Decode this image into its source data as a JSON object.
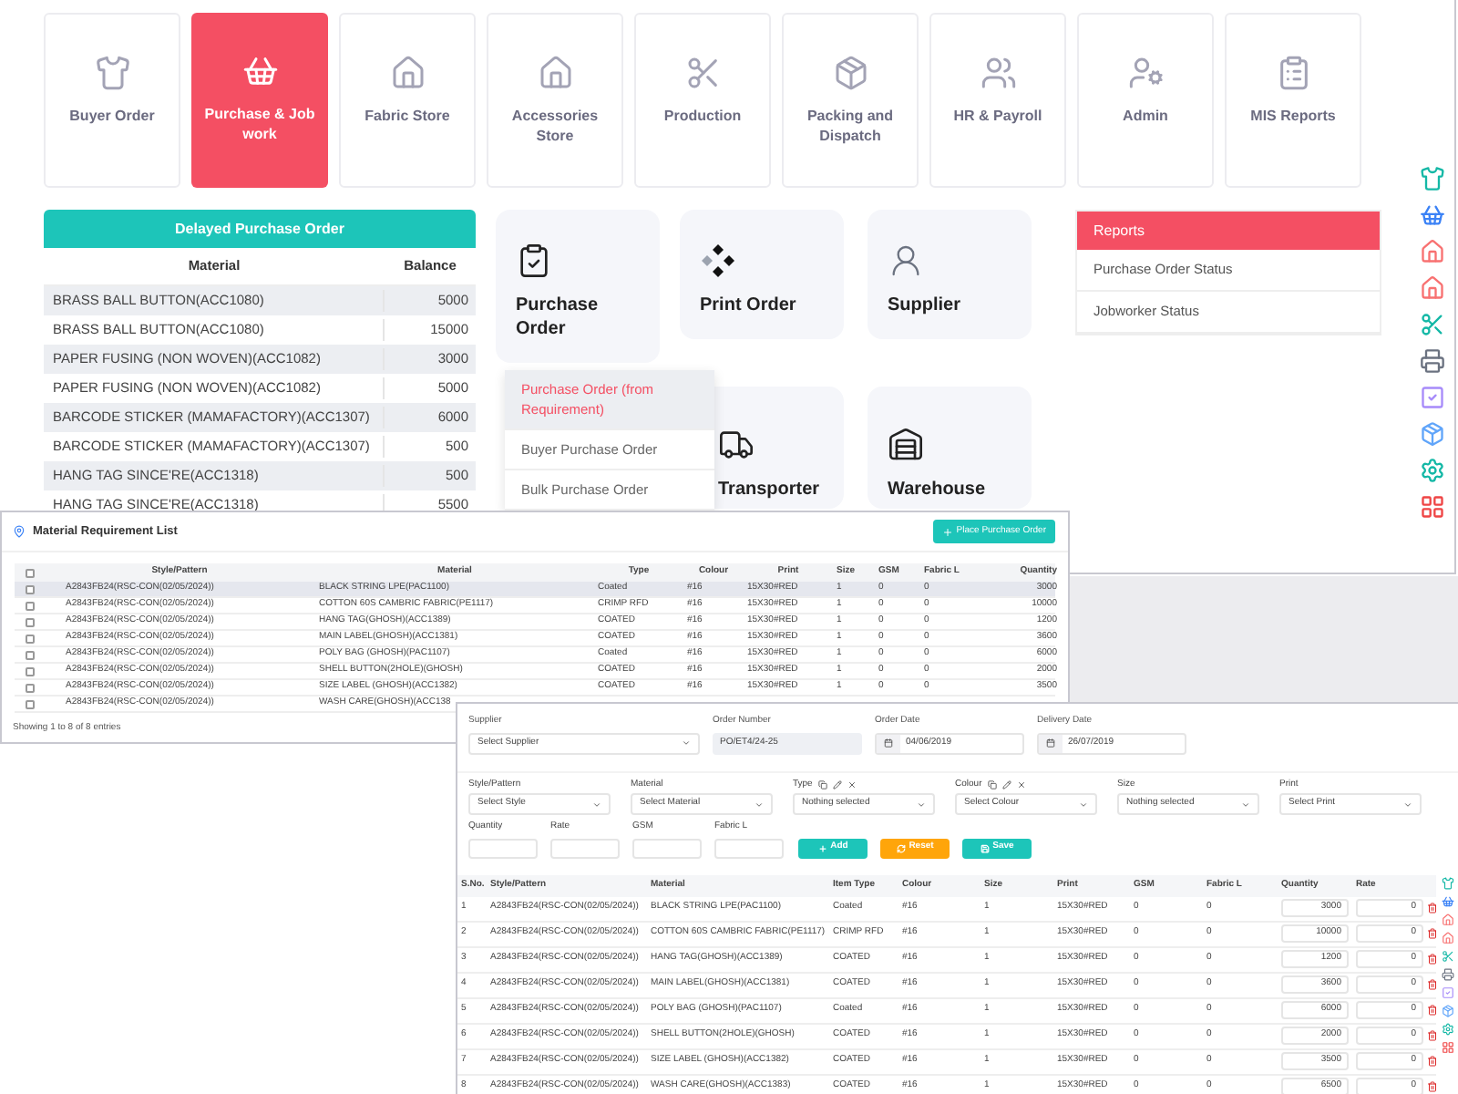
{
  "nav": [
    {
      "label": "Buyer Order",
      "selected": false
    },
    {
      "label": "Purchase & Job work",
      "selected": true
    },
    {
      "label": "Fabric Store",
      "selected": false
    },
    {
      "label": "Accessories Store",
      "selected": false
    },
    {
      "label": "Production",
      "selected": false
    },
    {
      "label": "Packing and Dispatch",
      "selected": false
    },
    {
      "label": "HR & Payroll",
      "selected": false
    },
    {
      "label": "Admin",
      "selected": false
    },
    {
      "label": "MIS Reports",
      "selected": false
    }
  ],
  "delayed_purchase_order": {
    "title": "Delayed Purchase Order",
    "columns": [
      "Material",
      "Balance"
    ],
    "rows": [
      {
        "material": "BRASS BALL BUTTON(ACC1080)",
        "balance": "5000"
      },
      {
        "material": "BRASS BALL BUTTON(ACC1080)",
        "balance": "15000"
      },
      {
        "material": "PAPER FUSING (NON WOVEN)(ACC1082)",
        "balance": "3000"
      },
      {
        "material": "PAPER FUSING (NON WOVEN)(ACC1082)",
        "balance": "5000"
      },
      {
        "material": "BARCODE STICKER (MAMAFACTORY)(ACC1307)",
        "balance": "6000"
      },
      {
        "material": "BARCODE STICKER (MAMAFACTORY)(ACC1307)",
        "balance": "500"
      },
      {
        "material": "HANG TAG SINCE'RE(ACC1318)",
        "balance": "500"
      },
      {
        "material": "HANG TAG SINCE'RE(ACC1318)",
        "balance": "5500"
      }
    ]
  },
  "tiles": [
    {
      "label": "Purchase Order"
    },
    {
      "label": "Print Order"
    },
    {
      "label": "Supplier"
    },
    {
      "label": "Transporter"
    },
    {
      "label": "Warehouse"
    }
  ],
  "tile_menu": [
    {
      "label": "Purchase Order (from Requirement)",
      "selected": true
    },
    {
      "label": "Buyer Purchase Order",
      "selected": false
    },
    {
      "label": "Bulk Purchase Order",
      "selected": false
    }
  ],
  "reports": {
    "title": "Reports",
    "items": [
      "Purchase Order Status",
      "Jobworker Status"
    ]
  },
  "material_requirement_list": {
    "title": "Material Requirement List",
    "button": "Place Purchase Order",
    "header_checked": false,
    "columns": [
      "Style/Pattern",
      "Material",
      "Type",
      "Colour",
      "Print",
      "Size",
      "GSM",
      "Fabric L",
      "Quantity"
    ],
    "rows": [
      {
        "selected": true,
        "checked": false,
        "cells": [
          "A2843FB24(RSC-CON(02/05/2024))",
          "BLACK STRING LPE(PAC1100)",
          "Coated",
          "#16",
          "15X30#RED",
          "1",
          "0",
          "0",
          "3000"
        ]
      },
      {
        "selected": false,
        "checked": false,
        "cells": [
          "A2843FB24(RSC-CON(02/05/2024))",
          "COTTON 60S CAMBRIC FABRIC(PE1117)",
          "CRIMP RFD",
          "#16",
          "15X30#RED",
          "1",
          "0",
          "0",
          "10000"
        ]
      },
      {
        "selected": false,
        "checked": false,
        "cells": [
          "A2843FB24(RSC-CON(02/05/2024))",
          "HANG TAG(GHOSH)(ACC1389)",
          "COATED",
          "#16",
          "15X30#RED",
          "1",
          "0",
          "0",
          "1200"
        ]
      },
      {
        "selected": false,
        "checked": false,
        "cells": [
          "A2843FB24(RSC-CON(02/05/2024))",
          "MAIN LABEL(GHOSH)(ACC1381)",
          "COATED",
          "#16",
          "15X30#RED",
          "1",
          "0",
          "0",
          "3600"
        ]
      },
      {
        "selected": false,
        "checked": false,
        "cells": [
          "A2843FB24(RSC-CON(02/05/2024))",
          "POLY BAG (GHOSH)(PAC1107)",
          "Coated",
          "#16",
          "15X30#RED",
          "1",
          "0",
          "0",
          "6000"
        ]
      },
      {
        "selected": false,
        "checked": false,
        "cells": [
          "A2843FB24(RSC-CON(02/05/2024))",
          "SHELL BUTTON(2HOLE)(GHOSH)",
          "COATED",
          "#16",
          "15X30#RED",
          "1",
          "0",
          "0",
          "2000"
        ]
      },
      {
        "selected": false,
        "checked": false,
        "cells": [
          "A2843FB24(RSC-CON(02/05/2024))",
          "SIZE LABEL (GHOSH)(ACC1382)",
          "COATED",
          "#16",
          "15X30#RED",
          "1",
          "0",
          "0",
          "3500"
        ]
      },
      {
        "selected": false,
        "checked": false,
        "cells": [
          "A2843FB24(RSC-CON(02/05/2024))",
          "WASH CARE(GHOSH)(ACC138"
        ]
      }
    ],
    "footer": "Showing 1 to 8 of 8 entries"
  },
  "purchase_form": {
    "header_fields": [
      {
        "label": "Supplier",
        "kind": "select",
        "value": "Select Supplier"
      },
      {
        "label": "Order Number",
        "kind": "readonly",
        "value": "PO/ET4/24-25"
      },
      {
        "label": "Order Date",
        "kind": "date",
        "value": "04/06/2019"
      },
      {
        "label": "Delivery Date",
        "kind": "date",
        "value": "26/07/2019"
      }
    ],
    "item_fields": [
      {
        "label": "Style/Pattern",
        "value": "Select Style",
        "tools": false
      },
      {
        "label": "Material",
        "value": "Select Material",
        "tools": false
      },
      {
        "label": "Type",
        "value": "Nothing selected",
        "tools": true
      },
      {
        "label": "Colour",
        "value": "Select Colour",
        "tools": true
      },
      {
        "label": "Size",
        "value": "Nothing selected",
        "tools": false
      },
      {
        "label": "Print",
        "value": "Select Print",
        "tools": false
      }
    ],
    "inputs": [
      {
        "label": "Quantity"
      },
      {
        "label": "Rate"
      },
      {
        "label": "GSM"
      },
      {
        "label": "Fabric L"
      }
    ],
    "buttons": [
      {
        "label": "Add",
        "kind": "add"
      },
      {
        "label": "Reset",
        "kind": "reset"
      },
      {
        "label": "Save",
        "kind": "save"
      }
    ],
    "columns": [
      "S.No.",
      "Style/Pattern",
      "Material",
      "Item Type",
      "Colour",
      "Size",
      "Print",
      "GSM",
      "Fabric L",
      "Quantity",
      "Rate"
    ],
    "rows": [
      {
        "cells": [
          "1",
          "A2843FB24(RSC-CON(02/05/2024))",
          "BLACK STRING LPE(PAC1100)",
          "Coated",
          "#16",
          "1",
          "15X30#RED",
          "0",
          "0"
        ],
        "quantity": "3000",
        "rate": "0"
      },
      {
        "cells": [
          "2",
          "A2843FB24(RSC-CON(02/05/2024))",
          "COTTON 60S CAMBRIC FABRIC(PE1117)",
          "CRIMP RFD",
          "#16",
          "1",
          "15X30#RED",
          "0",
          "0"
        ],
        "quantity": "10000",
        "rate": "0"
      },
      {
        "cells": [
          "3",
          "A2843FB24(RSC-CON(02/05/2024))",
          "HANG TAG(GHOSH)(ACC1389)",
          "COATED",
          "#16",
          "1",
          "15X30#RED",
          "0",
          "0"
        ],
        "quantity": "1200",
        "rate": "0"
      },
      {
        "cells": [
          "4",
          "A2843FB24(RSC-CON(02/05/2024))",
          "MAIN LABEL(GHOSH)(ACC1381)",
          "COATED",
          "#16",
          "1",
          "15X30#RED",
          "0",
          "0"
        ],
        "quantity": "3600",
        "rate": "0"
      },
      {
        "cells": [
          "5",
          "A2843FB24(RSC-CON(02/05/2024))",
          "POLY BAG (GHOSH)(PAC1107)",
          "Coated",
          "#16",
          "1",
          "15X30#RED",
          "0",
          "0"
        ],
        "quantity": "6000",
        "rate": "0"
      },
      {
        "cells": [
          "6",
          "A2843FB24(RSC-CON(02/05/2024))",
          "SHELL BUTTON(2HOLE)(GHOSH)",
          "COATED",
          "#16",
          "1",
          "15X30#RED",
          "0",
          "0"
        ],
        "quantity": "2000",
        "rate": "0"
      },
      {
        "cells": [
          "7",
          "A2843FB24(RSC-CON(02/05/2024))",
          "SIZE LABEL (GHOSH)(ACC1382)",
          "COATED",
          "#16",
          "1",
          "15X30#RED",
          "0",
          "0"
        ],
        "quantity": "3500",
        "rate": "0"
      },
      {
        "cells": [
          "8",
          "A2843FB24(RSC-CON(02/05/2024))",
          "WASH CARE(GHOSH)(ACC1383)",
          "COATED",
          "#16",
          "1",
          "15X30#RED",
          "0",
          "0"
        ],
        "quantity": "6500",
        "rate": "0"
      }
    ]
  }
}
